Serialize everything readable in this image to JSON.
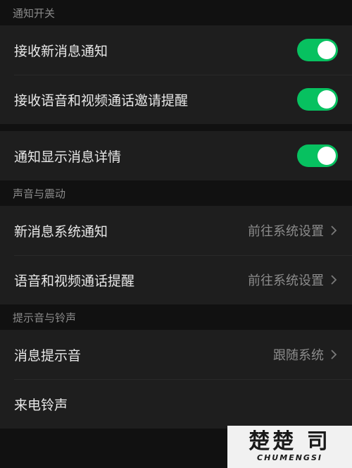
{
  "sections": {
    "notify": {
      "title": "通知开关",
      "items": [
        {
          "label": "接收新消息通知",
          "on": true
        },
        {
          "label": "接收语音和视频通话邀请提醒",
          "on": true
        },
        {
          "label": "通知显示消息详情",
          "on": true
        }
      ]
    },
    "sound": {
      "title": "声音与震动",
      "items": [
        {
          "label": "新消息系统通知",
          "value": "前往系统设置"
        },
        {
          "label": "语音和视频通话提醒",
          "value": "前往系统设置"
        }
      ]
    },
    "tone": {
      "title": "提示音与铃声",
      "items": [
        {
          "label": "消息提示音",
          "value": "跟随系统"
        },
        {
          "label": "来电铃声",
          "value": ""
        }
      ]
    }
  },
  "watermark": {
    "top": "楚楚 司",
    "bottom": "CHUMENGSI"
  },
  "colors": {
    "toggle_on": "#07c160",
    "background": "#111111",
    "cell": "#1e1e1e"
  }
}
